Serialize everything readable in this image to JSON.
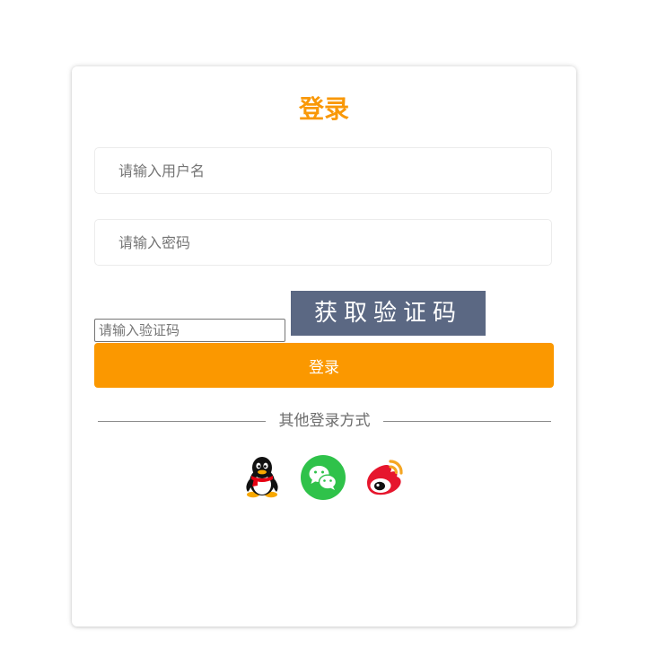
{
  "login": {
    "title": "登录",
    "username_placeholder": "请输入用户名",
    "password_placeholder": "请输入密码",
    "captcha_placeholder": "请输入验证码",
    "captcha_button_label": "获取验证码",
    "submit_label": "登录",
    "other_methods_label": "其他登录方式"
  },
  "social": [
    {
      "icon": "qq-icon"
    },
    {
      "icon": "wechat-icon"
    },
    {
      "icon": "weibo-icon"
    }
  ],
  "colors": {
    "accent": "#fb9800",
    "title": "#f99807",
    "captcha_bg": "#5b6883",
    "wechat_green": "#2fc24a",
    "weibo_red": "#e6162d",
    "weibo_orange": "#f5a623"
  }
}
